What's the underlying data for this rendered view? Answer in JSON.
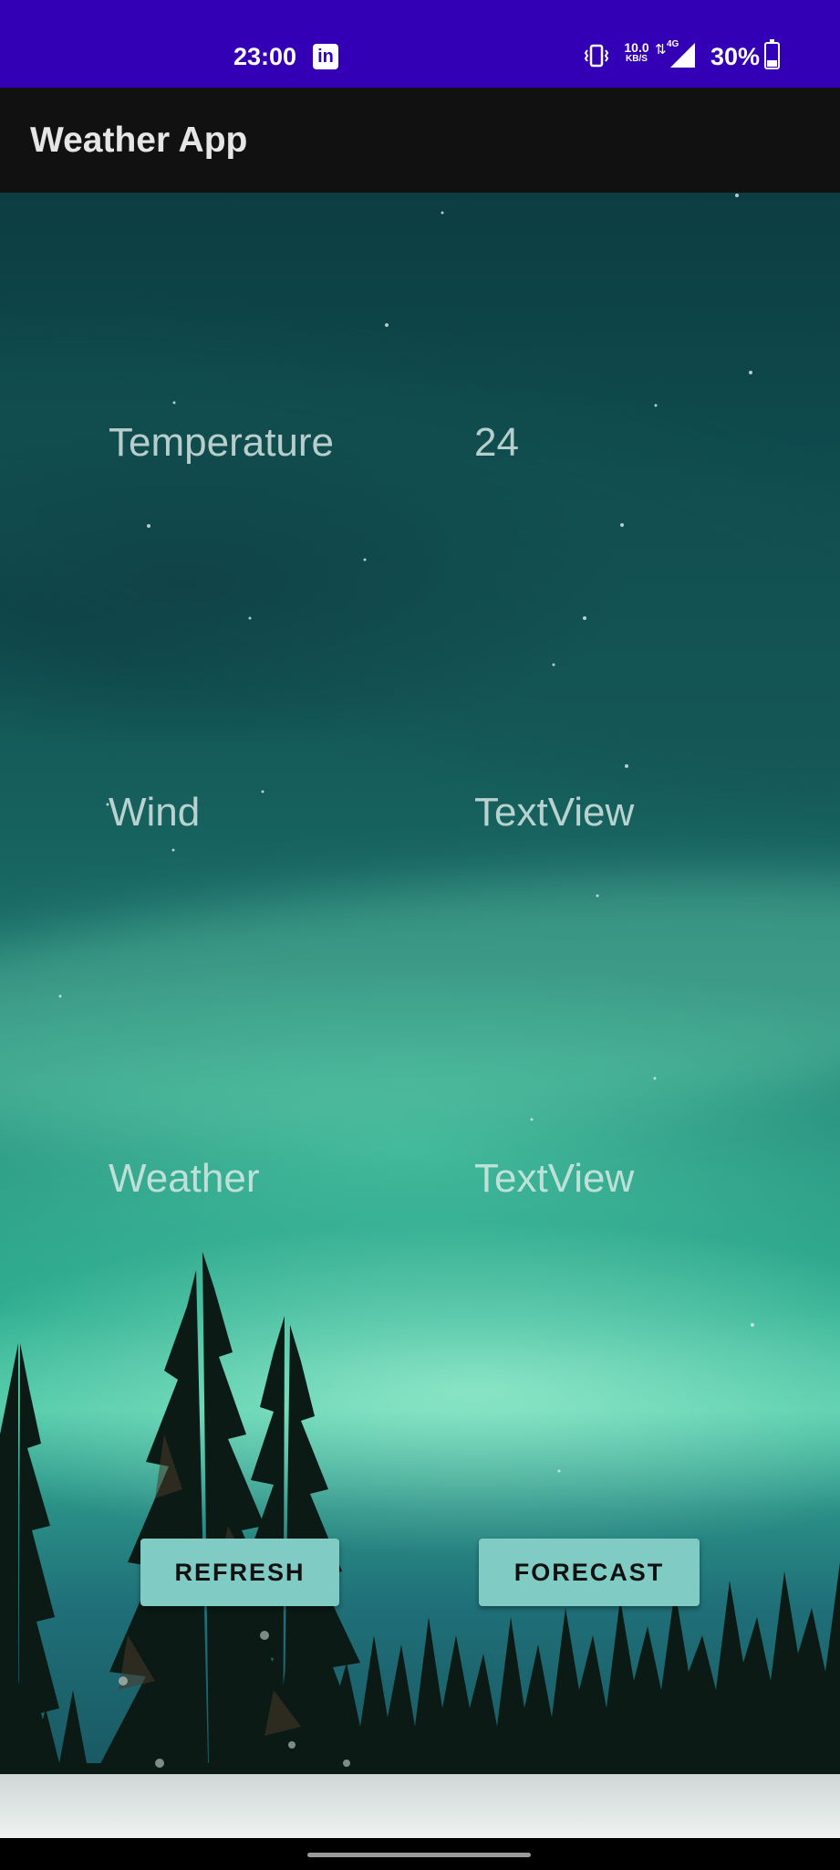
{
  "status_bar": {
    "time": "23:00",
    "net_speed_value": "10.0",
    "net_speed_unit": "KB/S",
    "network_type": "4G",
    "battery_percent": "30%",
    "icons": [
      "linkedin-icon",
      "vibrate-icon",
      "data-arrows-icon",
      "signal-icon",
      "battery-charging-icon"
    ]
  },
  "app_bar": {
    "title": "Weather App"
  },
  "fields": {
    "temperature": {
      "label": "Temperature",
      "value": "24"
    },
    "wind": {
      "label": "Wind",
      "value": "TextView"
    },
    "weather": {
      "label": "Weather",
      "value": "TextView"
    }
  },
  "buttons": {
    "refresh": "REFRESH",
    "forecast": "FORECAST"
  },
  "colors": {
    "status_bar": "#3300b5",
    "app_bar": "#111111",
    "button": "#80cbc4"
  }
}
